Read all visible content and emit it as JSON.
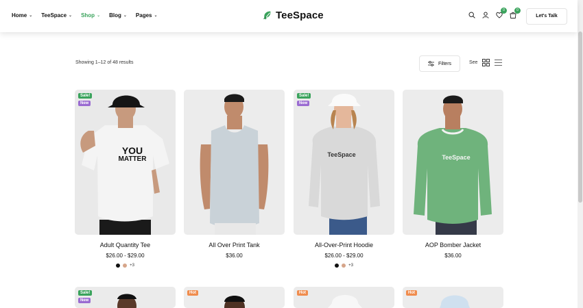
{
  "header": {
    "nav": [
      {
        "label": "Home",
        "has_dropdown": true,
        "active": false
      },
      {
        "label": "TeeSpace",
        "has_dropdown": true,
        "active": false
      },
      {
        "label": "Shop",
        "has_dropdown": true,
        "active": true
      },
      {
        "label": "Blog",
        "has_dropdown": true,
        "active": false
      },
      {
        "label": "Pages",
        "has_dropdown": true,
        "active": false
      }
    ],
    "chevron": "⌄",
    "logo_text": "TeeSpace",
    "logo_icon": "leaf-hand-icon",
    "wishlist_count": "0",
    "cart_count": "0",
    "cta_label": "Let's Talk",
    "accent": "#3aa35c"
  },
  "toolbar": {
    "results_text": "Showing 1–12 of 48 results",
    "filters_label": "Filters",
    "see_label": "See"
  },
  "products": [
    {
      "name": "Adult Quantity Tee",
      "price": "$26.00 - $29.00",
      "tags": [
        "Sale!",
        "New"
      ],
      "swatches": [
        "#111111",
        "#d6a58a"
      ],
      "more": "+3",
      "shirt_text_1": "YOU",
      "shirt_text_2": "MATTER"
    },
    {
      "name": "All Over Print Tank",
      "price": "$36.00",
      "tags": [],
      "swatches": [],
      "more": ""
    },
    {
      "name": "All-Over-Print Hoodie",
      "price": "$26.00 - $29.00",
      "tags": [
        "Sale!",
        "New"
      ],
      "swatches": [
        "#111111",
        "#d6a58a"
      ],
      "more": "+3",
      "shirt_text_1": "TeeSpace"
    },
    {
      "name": "AOP Bomber Jacket",
      "price": "$36.00",
      "tags": [],
      "swatches": [],
      "more": "",
      "shirt_text_1": "TeeSpace"
    }
  ],
  "second_row_tags": [
    [
      "Sale!",
      "New"
    ],
    [
      "Hot"
    ],
    [
      "Hot"
    ],
    [
      "Hot"
    ]
  ]
}
